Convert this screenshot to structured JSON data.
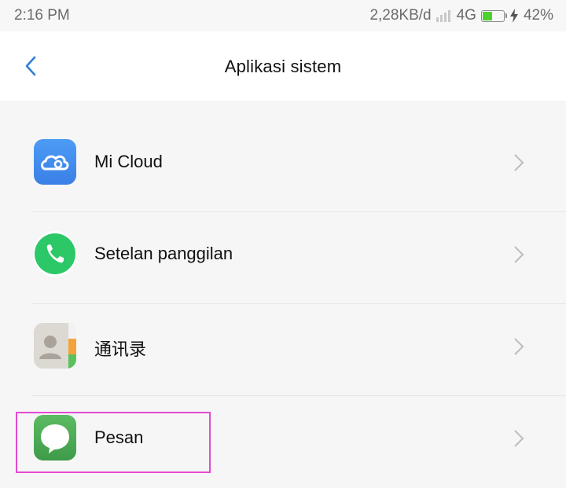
{
  "status_bar": {
    "time": "2:16 PM",
    "network_speed": "2,28KB/d",
    "network_type": "4G",
    "battery_percent": "42%",
    "battery_level": 0.42
  },
  "header": {
    "title": "Aplikasi sistem",
    "back_icon": "chevron-left-icon"
  },
  "items": [
    {
      "label": "Mi Cloud",
      "icon": "mi-cloud-icon",
      "color": "#3f8ff0"
    },
    {
      "label": "Setelan panggilan",
      "icon": "phone-icon",
      "color": "#2cc868"
    },
    {
      "label": "通讯录",
      "icon": "contacts-icon",
      "color": "#dcd8d2"
    },
    {
      "label": "Pesan",
      "icon": "message-bubble-icon",
      "color": "#4fae58"
    }
  ],
  "colors": {
    "accent": "#2f7fd6",
    "highlight": "#e34ad3"
  }
}
